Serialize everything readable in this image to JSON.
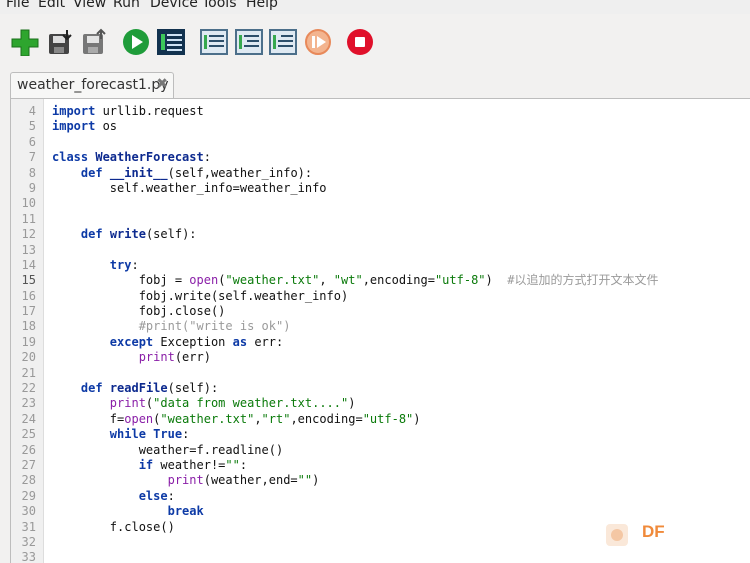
{
  "menu": [
    "File",
    "Edit",
    "View",
    "Run",
    "Device",
    "Tools",
    "Help"
  ],
  "tab": {
    "title": "weather_forecast1.py",
    "close": "✖"
  },
  "current_line": "15",
  "watermark": "DF",
  "code_lines": [
    {
      "n": "4",
      "t": "import urllib.request"
    },
    {
      "n": "5",
      "t": "import os"
    },
    {
      "n": "6",
      "t": ""
    },
    {
      "n": "7",
      "t": "class WeatherForecast:"
    },
    {
      "n": "8",
      "t": "    def __init__(self,weather_info):"
    },
    {
      "n": "9",
      "t": "        self.weather_info=weather_info"
    },
    {
      "n": "10",
      "t": ""
    },
    {
      "n": "11",
      "t": ""
    },
    {
      "n": "12",
      "t": "    def write(self):"
    },
    {
      "n": "13",
      "t": ""
    },
    {
      "n": "14",
      "t": "        try:"
    },
    {
      "n": "15",
      "t": "            fobj = open(\"weather.txt\", \"wt\",encoding=\"utf-8\")  #以追加的方式打开文本文件"
    },
    {
      "n": "16",
      "t": "            fobj.write(self.weather_info)"
    },
    {
      "n": "17",
      "t": "            fobj.close()"
    },
    {
      "n": "18",
      "t": "            #print(\"write is ok\")"
    },
    {
      "n": "19",
      "t": "        except Exception as err:"
    },
    {
      "n": "20",
      "t": "            print(err)"
    },
    {
      "n": "21",
      "t": ""
    },
    {
      "n": "22",
      "t": "    def readFile(self):"
    },
    {
      "n": "23",
      "t": "        print(\"data from weather.txt....\")"
    },
    {
      "n": "24",
      "t": "        f=open(\"weather.txt\",\"rt\",encoding=\"utf-8\")"
    },
    {
      "n": "25",
      "t": "        while True:"
    },
    {
      "n": "26",
      "t": "            weather=f.readline()"
    },
    {
      "n": "27",
      "t": "            if weather!=\"\":"
    },
    {
      "n": "28",
      "t": "                print(weather,end=\"\")"
    },
    {
      "n": "29",
      "t": "            else:"
    },
    {
      "n": "30",
      "t": "                break"
    },
    {
      "n": "31",
      "t": "        f.close()"
    },
    {
      "n": "32",
      "t": ""
    },
    {
      "n": "33",
      "t": ""
    }
  ],
  "colors": {
    "keyword": "#0d3aa6",
    "string": "#0a7a0a",
    "builtin": "#8a1fa8",
    "comment": "#9a9a9a",
    "accent": "#f08a3a"
  },
  "toolbar_icons": [
    "new-file-icon",
    "load-file-icon",
    "save-file-icon",
    "run-icon",
    "debug-icon",
    "step-over-icon",
    "step-into-icon",
    "step-out-icon",
    "resume-icon",
    "stop-icon"
  ]
}
